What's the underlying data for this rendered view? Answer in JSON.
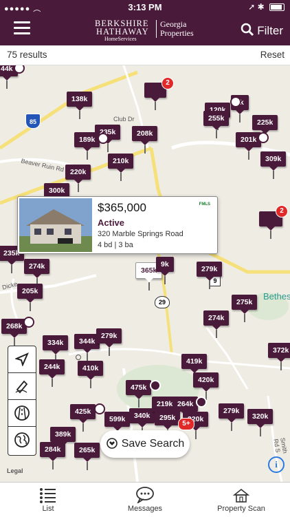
{
  "status_bar": {
    "time": "3:13 PM"
  },
  "header": {
    "logo_line1": "BERKSHIRE",
    "logo_line2": "HATHAWAY",
    "logo_line3": "HomeServices",
    "logo_region1": "Georgia",
    "logo_region2": "Properties",
    "filter_label": "Filter"
  },
  "results": {
    "count": "75 results",
    "reset_label": "Reset"
  },
  "pins": [
    {
      "label": "44k"
    },
    {
      "label": "138k"
    },
    {
      "label": "235k"
    },
    {
      "label": "189k"
    },
    {
      "label": "208k"
    },
    {
      "label": "210k"
    },
    {
      "label": "220k"
    },
    {
      "label": "300k"
    },
    {
      "label": "120k"
    },
    {
      "label": "255k"
    },
    {
      "label": "4k"
    },
    {
      "label": "225k"
    },
    {
      "label": "201k"
    },
    {
      "label": "309k"
    },
    {
      "label": "235k"
    },
    {
      "label": "274k"
    },
    {
      "label": "205k"
    },
    {
      "label": "365k"
    },
    {
      "label": "279k"
    },
    {
      "label": "275k"
    },
    {
      "label": "274k"
    },
    {
      "label": "268k"
    },
    {
      "label": "334k"
    },
    {
      "label": "344k"
    },
    {
      "label": "279k"
    },
    {
      "label": "244k"
    },
    {
      "label": "410k"
    },
    {
      "label": "372k"
    },
    {
      "label": "419k"
    },
    {
      "label": "420k"
    },
    {
      "label": "475k"
    },
    {
      "label": "425k"
    },
    {
      "label": "599k"
    },
    {
      "label": "340k"
    },
    {
      "label": "219k"
    },
    {
      "label": "264k"
    },
    {
      "label": "295k"
    },
    {
      "label": "320k"
    },
    {
      "label": "279k"
    },
    {
      "label": "320k"
    },
    {
      "label": "389k"
    },
    {
      "label": "284k"
    },
    {
      "label": "265k"
    },
    {
      "label": "9k"
    }
  ],
  "badges": {
    "b1": "2",
    "b2": "2",
    "b3": "5+"
  },
  "listing_card": {
    "price": "$365,000",
    "status": "Active",
    "address": "320 Marble Springs Road",
    "beds_baths": "4 bd | 3 ba",
    "mls_logo": "FMLS"
  },
  "map_labels": {
    "club_dr": "Club Dr",
    "beaver_ruin": "Beaver Ruin Rd",
    "dickens": "Dicke",
    "interstate": "85",
    "hwy29": "29",
    "hwy9": "9",
    "bethesda": "Bethes",
    "auburn": "urn",
    "smith_rd": "Smith Rd S"
  },
  "save_search_label": "Save Search",
  "legal_label": "Legal",
  "info_label": "i",
  "tabs": [
    {
      "label": "List"
    },
    {
      "label": "Messages"
    },
    {
      "label": "Property Scan"
    }
  ]
}
